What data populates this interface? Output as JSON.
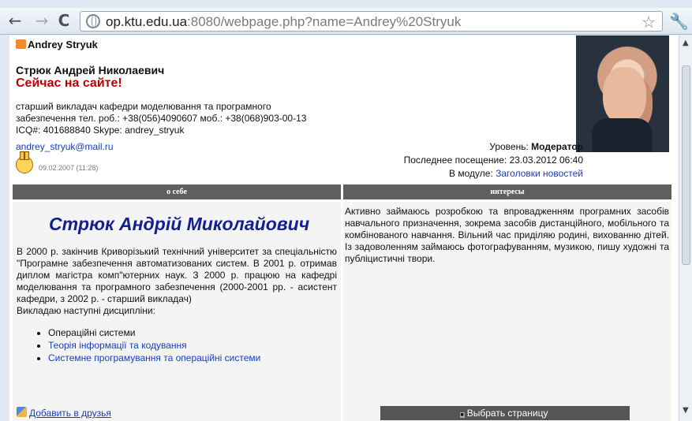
{
  "browser": {
    "back": "←",
    "forward": "→",
    "reload": "C",
    "url_host": "op.ktu.edu.ua",
    "url_rest": ":8080/webpage.php?name=Andrey%20Stryuk",
    "bookmark": "☆",
    "menu": "🔧"
  },
  "profile": {
    "short_name": "Andrey Stryuk",
    "full_name": "Стрюк Андрей Николаевич",
    "online_status": "Сейчас на сайте!",
    "bio_lines": [
      "старший викладач кафедри моделювання та програмного",
      "забезпечення тел. роб.: +38(056)4090607 моб.: +38(068)903-00-13",
      "ICQ#: 401688840 Skype: andrey_stryuk"
    ],
    "email": "andrey_stryuk@mail.ru",
    "date": "09.02.2007 (11:28)",
    "level_label": "Уровень: ",
    "level_value": "Модератор",
    "last_visit": "Последнее посещение: 23.03.2012 06:40",
    "module_label": "В модуле: ",
    "module_link": "Заголовки новостей"
  },
  "tables": {
    "about_header": "о себе",
    "interests_header": "интересы",
    "about_title": "Стрюк Андрій Миколайович",
    "about_text": "В 2000 р. закінчив Криворізький технічний університет за спеціальністю \"Програмне забезпечення автоматизованих систем. В 2001 р. отримав диплом магістра комп\"ютерних наук. З 2000 р. працюю на кафедрі моделювання та програмного забезпечення (2000-2001 рр. - асистент кафедри, з 2002 р. - старший викладач)",
    "disciplines_title": "Викладаю наступні дисципліни:",
    "disciplines": [
      "Операційні системи",
      "Теорія інформації та кодування",
      "Системне програмування та операційні системи"
    ],
    "interests_text": "Активно займаюсь розробкою та впровадженням програмних засобів навчального призначення, зокрема засобів дистанційного, мобільного та комбінованого навчання. Вільний час приділяю родині, вихованню дітей. Із задоволенням займаюсь фотографуванням, музикою, пишу художні та публіцистичні твори."
  },
  "footer": {
    "add_friend": "Добавить в друзья",
    "select_page": "Выбрать страницу"
  },
  "colors": {
    "link": "#1640b8",
    "online": "#c00000",
    "table_header": "#5f5f5f"
  }
}
